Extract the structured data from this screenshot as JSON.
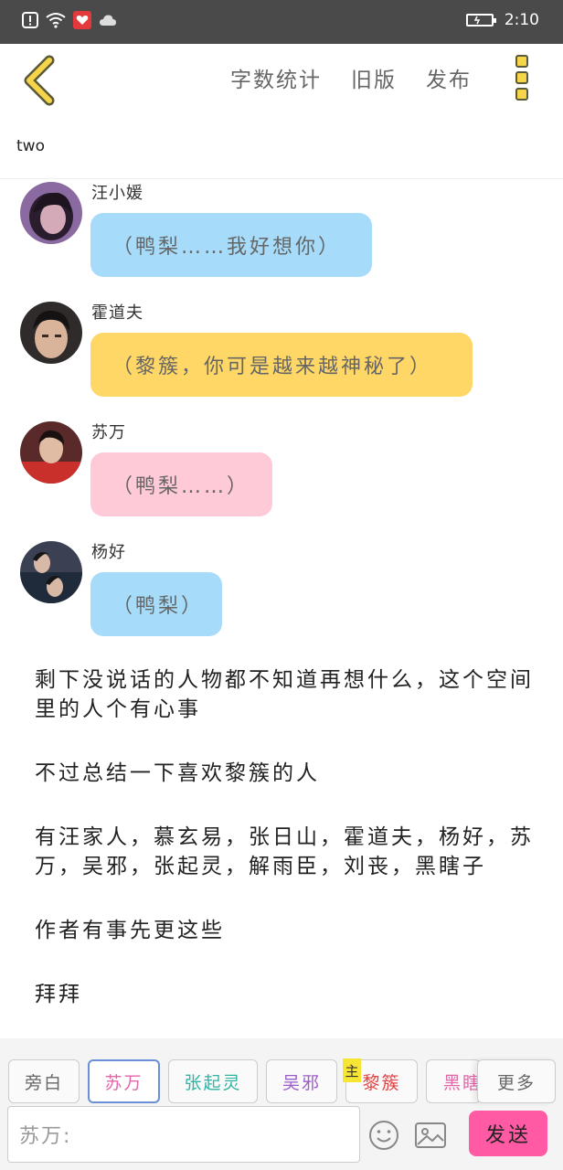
{
  "status_bar": {
    "time": "2:10"
  },
  "toolbar": {
    "links": [
      "字数统计",
      "旧版",
      "发布"
    ]
  },
  "chapter_title": "two",
  "messages": [
    {
      "name": "汪小媛",
      "text": "（鸭梨……我好想你）",
      "bubble_color": "#a6dcf9"
    },
    {
      "name": "霍道夫",
      "text": "（黎簇，你可是越来越神秘了）",
      "bubble_color": "#ffd766"
    },
    {
      "name": "苏万",
      "text": "（鸭梨……）",
      "bubble_color": "#ffcad8"
    },
    {
      "name": "杨好",
      "text": "（鸭梨）",
      "bubble_color": "#a6dcf9"
    }
  ],
  "story": [
    "剩下没说话的人物都不知道再想什么，这个空间里的人个有心事",
    "不过总结一下喜欢黎簇的人",
    "有汪家人，慕玄易，张日山，霍道夫，杨好，苏万，吴邪，张起灵，解雨臣，刘丧，黑瞎子",
    "作者有事先更这些",
    "拜拜"
  ],
  "characters": [
    {
      "label": "旁白",
      "color": "#666666"
    },
    {
      "label": "苏万",
      "color": "#e067a8"
    },
    {
      "label": "张起灵",
      "color": "#2fb3a3"
    },
    {
      "label": "吴邪",
      "color": "#9b5cc9"
    },
    {
      "label": "黎簇",
      "color": "#e04444"
    },
    {
      "label": "黑瞎",
      "color": "#e067a8"
    }
  ],
  "main_badge": "主",
  "more_label": "更多",
  "input": {
    "speaker": "苏万:"
  },
  "send_label": "发送"
}
